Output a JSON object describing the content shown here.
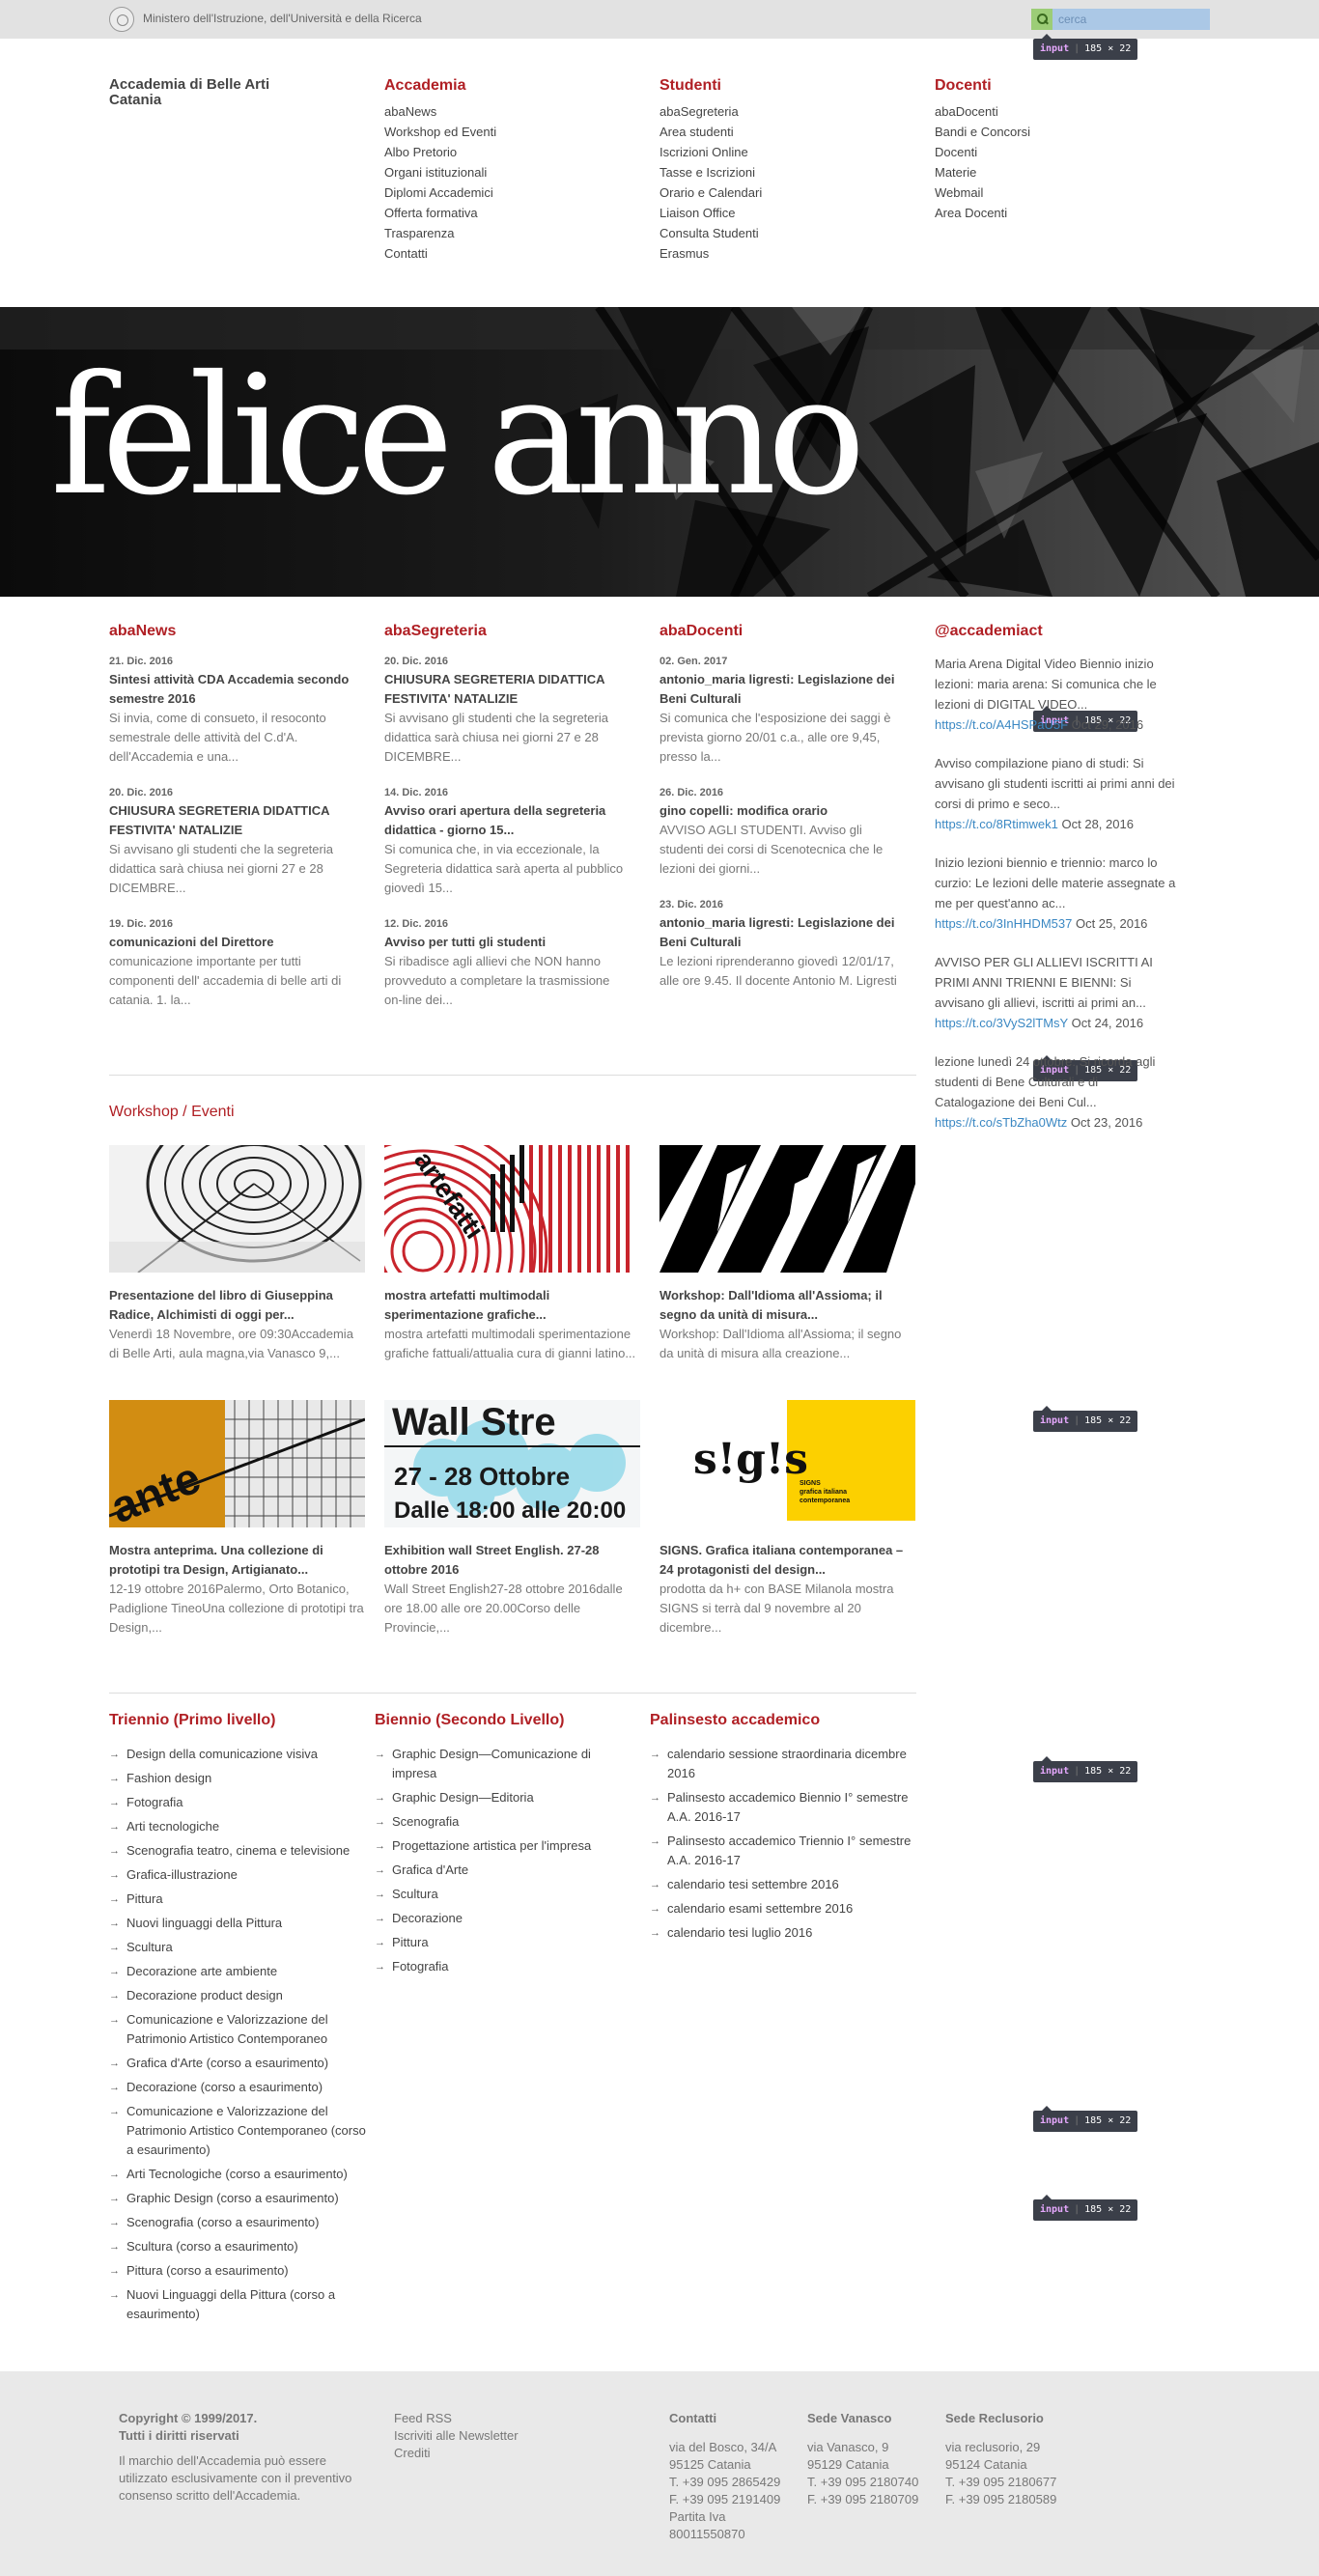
{
  "topbar": {
    "ministry": "Ministero dell'Istruzione, dell'Università e della Ricerca",
    "search_placeholder": "cerca"
  },
  "inspector": {
    "tag": "input",
    "size": "185 × 22"
  },
  "brand": {
    "line1": "Accademia di Belle Arti",
    "line2": "Catania"
  },
  "nav": [
    {
      "title": "Accademia",
      "items": [
        "abaNews",
        "Workshop ed Eventi",
        "Albo Pretorio",
        "Organi istituzionali",
        "Diplomi Accademici",
        "Offerta formativa",
        "Trasparenza",
        "Contatti"
      ]
    },
    {
      "title": "Studenti",
      "items": [
        "abaSegreteria",
        "Area studenti",
        "Iscrizioni Online",
        "Tasse e Iscrizioni",
        "Orario e Calendari",
        "Liaison Office",
        "Consulta Studenti",
        "Erasmus"
      ]
    },
    {
      "title": "Docenti",
      "items": [
        "abaDocenti",
        "Bandi e Concorsi",
        "Docenti",
        "Materie",
        "Webmail",
        "Area Docenti"
      ]
    }
  ],
  "hero": {
    "title": "felice anno"
  },
  "abanews": {
    "title": "abaNews",
    "items": [
      {
        "date": "21. Dic. 2016",
        "title": "Sintesi attività CDA Accademia secondo semestre 2016",
        "text": "Si invia, come di consueto, il resoconto semestrale delle attività del C.d'A. dell'Accademia e una..."
      },
      {
        "date": "20. Dic. 2016",
        "title": "CHIUSURA SEGRETERIA DIDATTICA FESTIVITA' NATALIZIE",
        "text": "Si avvisano gli studenti che la segreteria didattica sarà chiusa nei giorni 27 e 28 DICEMBRE..."
      },
      {
        "date": "19. Dic. 2016",
        "title": "comunicazioni del Direttore",
        "text": "comunicazione importante per tutti componenti dell' accademia di belle arti di catania. 1. la..."
      }
    ]
  },
  "abasegreteria": {
    "title": "abaSegreteria",
    "items": [
      {
        "date": "20. Dic. 2016",
        "title": "CHIUSURA SEGRETERIA DIDATTICA FESTIVITA' NATALIZIE",
        "text": "Si avvisano gli studenti che la segreteria didattica sarà chiusa nei giorni 27 e 28 DICEMBRE..."
      },
      {
        "date": "14. Dic. 2016",
        "title": "Avviso orari apertura della segreteria didattica - giorno 15...",
        "text": "Si comunica che, in via eccezionale, la Segreteria didattica sarà aperta al pubblico giovedì 15..."
      },
      {
        "date": "12. Dic. 2016",
        "title": "Avviso per tutti gli studenti",
        "text": "Si ribadisce agli allievi che NON hanno provveduto a completare la trasmissione on-line dei..."
      }
    ]
  },
  "abadocenti": {
    "title": "abaDocenti",
    "items": [
      {
        "date": "02. Gen. 2017",
        "title": "antonio_maria ligresti: Legislazione dei Beni Culturali",
        "text": "Si comunica che l'esposizione dei saggi è prevista giorno 20/01 c.a., alle ore 9,45, presso la..."
      },
      {
        "date": "26. Dic. 2016",
        "title": "gino copelli: modifica orario",
        "text": "AVVISO AGLI STUDENTI. Avviso gli studenti dei corsi di Scenotecnica che le lezioni dei giorni..."
      },
      {
        "date": "23. Dic. 2016",
        "title": "antonio_maria ligresti: Legislazione dei Beni Culturali",
        "text": "Le lezioni riprenderanno giovedì 12/01/17, alle ore 9.45.  Il docente Antonio M. Ligresti"
      }
    ]
  },
  "twitter": {
    "title": "@accademiact",
    "items": [
      {
        "text": "Maria Arena Digital Video Biennio inizio lezioni: maria arena: Si comunica che le lezioni di DIGITAL VIDEO...",
        "link": "https://t.co/A4HSPaU5F",
        "date": "Oct 29, 2016"
      },
      {
        "text": "Avviso compilazione piano di studi: Si avvisano gli studenti iscritti ai primi anni dei corsi di primo e seco...",
        "link": "https://t.co/8Rtimwek1",
        "date": "Oct 28, 2016"
      },
      {
        "text": "Inizio lezioni biennio e triennio: marco lo curzio: Le lezioni delle materie assegnate a me per quest'anno ac...",
        "link": "https://t.co/3InHHDM537",
        "date": "Oct 25, 2016"
      },
      {
        "text": "AVVISO PER GLI ALLIEVI ISCRITTI AI PRIMI ANNI TRIENNI E BIENNI: Si avvisano gli allievi, iscritti ai primi an...",
        "link": "https://t.co/3VyS2lTMsY",
        "date": "Oct 24, 2016"
      },
      {
        "text": "lezione lunedì 24 ottobre: Si ricorda agli studenti di Bene Culturali e di Catalogazione dei Beni Cul...",
        "link": "https://t.co/sTbZha0Wtz",
        "date": "Oct 23, 2016"
      }
    ]
  },
  "workshop": {
    "title": "Workshop / Eventi",
    "cards": [
      {
        "title": "Presentazione del libro di Giuseppina Radice, Alchimisti di oggi per...",
        "text": "Venerdì 18 Novembre, ore 09:30Accademia di Belle Arti, aula magna,via Vanasco 9,..."
      },
      {
        "title": "mostra artefatti multimodali sperimentazione grafiche...",
        "text": "mostra artefatti multimodali sperimentazione grafiche fattuali/attualia cura di gianni latino...",
        "image_text": "artefatti"
      },
      {
        "title": "Workshop: Dall'Idioma all'Assioma; il segno da unità di misura...",
        "text": "Workshop: Dall'Idioma all'Assioma; il segno da unità di misura alla creazione..."
      },
      {
        "title": "Mostra anteprima. Una collezione di prototipi tra Design, Artigianato...",
        "text": "12-19 ottobre 2016Palermo, Orto Botanico, Padiglione TineoUna collezione di prototipi tra Design,...",
        "image_text": "ante"
      },
      {
        "title": "Exhibition wall Street English. 27-28 ottobre 2016",
        "text": "Wall Street English27-28 ottobre 2016dalle ore 18.00 alle ore 20.00Corso delle Provincie,...",
        "image_text": [
          "Wall Stre",
          "27 - 28 Ottobre",
          "Dalle 18:00 alle 20:00"
        ]
      },
      {
        "title": "SIGNS. Grafica italiana contemporanea – 24 protagonisti del design...",
        "text": "prodotta da h+ con BASE Milanola mostra SIGNS si terrà dal 9 novembre al 20 dicembre...",
        "image_text": [
          "s!g!s",
          "SIGNS",
          "grafica italiana",
          "contemporanea"
        ]
      }
    ]
  },
  "programs": [
    {
      "title": "Triennio (Primo livello)",
      "items": [
        "Design della comunicazione visiva",
        "Fashion design",
        "Fotografia",
        "Arti tecnologiche",
        "Scenografia teatro, cinema e televisione",
        "Grafica-illustrazione",
        "Pittura",
        "Nuovi linguaggi della Pittura",
        "Scultura",
        "Decorazione arte ambiente",
        "Decorazione product design",
        "Comunicazione e Valorizzazione del Patrimonio Artistico Contemporaneo",
        "Grafica d'Arte (corso a esaurimento)",
        "Decorazione (corso a esaurimento)",
        "Comunicazione e Valorizzazione del Patrimonio Artistico Contemporaneo (corso a esaurimento)",
        "Arti Tecnologiche (corso a esaurimento)",
        "Graphic Design (corso a esaurimento)",
        "Scenografia (corso a esaurimento)",
        "Scultura (corso a esaurimento)",
        "Pittura (corso a esaurimento)",
        "Nuovi Linguaggi della Pittura (corso a esaurimento)"
      ]
    },
    {
      "title": "Biennio (Secondo Livello)",
      "items": [
        "Graphic Design—Comunicazione di impresa",
        "Graphic Design—Editoria",
        "Scenografia",
        "Progettazione artistica per l'impresa",
        "Grafica d'Arte",
        "Scultura",
        "Decorazione",
        "Pittura",
        "Fotografia"
      ]
    },
    {
      "title": "Palinsesto accademico",
      "items": [
        "calendario sessione straordinaria dicembre 2016",
        "Palinsesto accademico Biennio I° semestre A.A. 2016-17",
        "Palinsesto accademico Triennio I° semestre A.A. 2016-17",
        "calendario tesi settembre 2016",
        "calendario esami settembre 2016",
        "calendario tesi luglio 2016"
      ]
    }
  ],
  "footer": {
    "copyright": "Copyright © 1999/2017.",
    "rights": "Tutti i diritti riservati",
    "note": "Il marchio dell'Accademia può essere utilizzato esclusivamente con il preventivo consenso scritto dell'Accademia.",
    "links": [
      "Feed RSS",
      "Iscriviti alle Newsletter",
      "Crediti"
    ],
    "contatti": {
      "title": "Contatti",
      "lines": [
        "via del Bosco, 34/A",
        "95125 Catania",
        "T. +39 095 2865429",
        "F. +39 095 2191409",
        "Partita Iva",
        "80011550870"
      ]
    },
    "vanasco": {
      "title": "Sede Vanasco",
      "lines": [
        "via Vanasco, 9",
        "95129 Catania",
        "T. +39 095 2180740",
        "F. +39 095 2180709"
      ]
    },
    "reclusorio": {
      "title": "Sede Reclusorio",
      "lines": [
        "via reclusorio, 29",
        "95124 Catania",
        "T. +39 095 2180677",
        "F. +39 095 2180589"
      ]
    }
  },
  "colors": {
    "accent": "#b01f24",
    "link": "#3b88c3",
    "topbar": "#e2e2e2",
    "footer": "#e9e9e9"
  }
}
